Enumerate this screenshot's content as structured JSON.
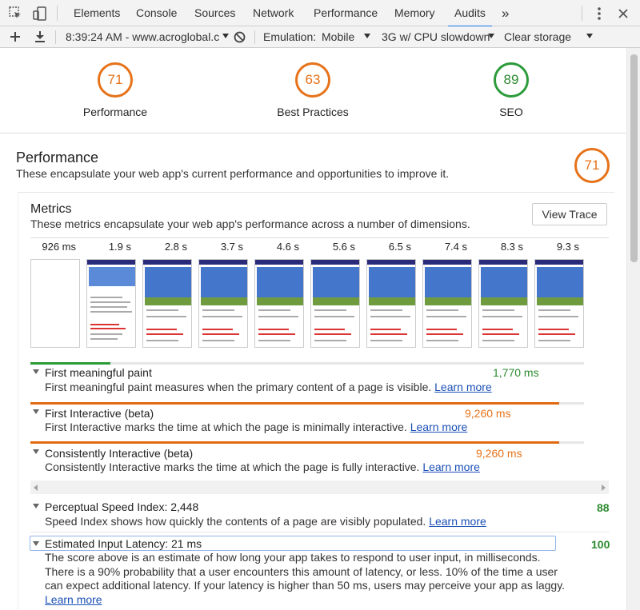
{
  "tabs": [
    "Elements",
    "Console",
    "Sources",
    "Network",
    "Performance",
    "Memory",
    "Audits"
  ],
  "active_tab": "Audits",
  "toolbar": {
    "time_url": "8:39:24 AM - www.acroglobal.c",
    "emulation_label": "Emulation:",
    "emulation_value": "Mobile",
    "throttle_value": "3G w/ CPU slowdown",
    "clear_storage": "Clear storage"
  },
  "scores": [
    {
      "value": "71",
      "label": "Performance",
      "color": "#e67219"
    },
    {
      "value": "63",
      "label": "Best Practices",
      "color": "#e67219"
    },
    {
      "value": "89",
      "label": "SEO",
      "color": "#2c9b3a"
    }
  ],
  "performance": {
    "title": "Performance",
    "description": "These encapsulate your web app's current performance and opportunities to improve it.",
    "score": "71"
  },
  "metrics": {
    "title": "Metrics",
    "description": "These metrics encapsulate your web app's performance across a number of dimensions.",
    "view_trace": "View Trace"
  },
  "filmstrip": [
    "926 ms",
    "1.9 s",
    "2.8 s",
    "3.7 s",
    "4.6 s",
    "5.6 s",
    "6.5 s",
    "7.4 s",
    "8.3 s",
    "9.3 s"
  ],
  "audits": [
    {
      "title": "First meaningful paint",
      "value": "1,770 ms",
      "value_color": "#2c8a2f",
      "desc": "First meaningful paint measures when the primary content of a page is visible.",
      "learn": "Learn more",
      "bar_color": "#2c9b3a",
      "bar_fraction": 0.145
    },
    {
      "title": "First Interactive (beta)",
      "value": "9,260 ms",
      "value_color": "#e67219",
      "desc": "First Interactive marks the time at which the page is minimally interactive.",
      "learn": "Learn more",
      "bar_color": "#e06a10",
      "bar_fraction": 0.955
    },
    {
      "title": "Consistently Interactive (beta)",
      "value": "9,260 ms",
      "value_color": "#e67219",
      "desc": "Consistently Interactive marks the time at which the page is fully interactive.",
      "learn": "Learn more",
      "bar_color": "#e06a10",
      "bar_fraction": 0.955
    }
  ],
  "perceptual": {
    "title": "Perceptual Speed Index: 2,448",
    "score": "88",
    "desc": "Speed Index shows how quickly the contents of a page are visibly populated.",
    "learn": "Learn more"
  },
  "latency": {
    "title": "Estimated Input Latency: 21 ms",
    "score": "100",
    "desc_lines": [
      "The score above is an estimate of how long your app takes to respond to user input, in milliseconds.",
      "There is a 90% probability that a user encounters this amount of latency, or less. 10% of the time a user",
      "can expect additional latency. If your latency is higher than 50 ms, users may perceive your app as laggy."
    ],
    "learn": "Learn more"
  }
}
